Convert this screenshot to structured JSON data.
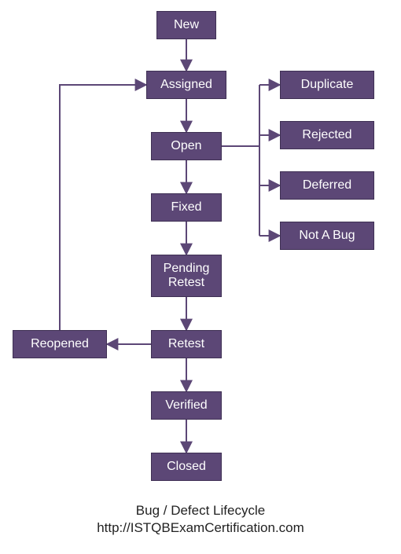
{
  "chart_data": {
    "type": "flowchart",
    "title": "Bug / Defect Lifecycle",
    "nodes": [
      {
        "id": "new",
        "label": "New"
      },
      {
        "id": "assigned",
        "label": "Assigned"
      },
      {
        "id": "open",
        "label": "Open"
      },
      {
        "id": "fixed",
        "label": "Fixed"
      },
      {
        "id": "pending_retest",
        "label": "Pending Retest"
      },
      {
        "id": "retest",
        "label": "Retest"
      },
      {
        "id": "verified",
        "label": "Verified"
      },
      {
        "id": "closed",
        "label": "Closed"
      },
      {
        "id": "reopened",
        "label": "Reopened"
      },
      {
        "id": "duplicate",
        "label": "Duplicate"
      },
      {
        "id": "rejected",
        "label": "Rejected"
      },
      {
        "id": "deferred",
        "label": "Deferred"
      },
      {
        "id": "not_a_bug",
        "label": "Not A Bug"
      }
    ],
    "edges": [
      {
        "from": "new",
        "to": "assigned"
      },
      {
        "from": "assigned",
        "to": "open"
      },
      {
        "from": "open",
        "to": "fixed"
      },
      {
        "from": "open",
        "to": "duplicate"
      },
      {
        "from": "open",
        "to": "rejected"
      },
      {
        "from": "open",
        "to": "deferred"
      },
      {
        "from": "open",
        "to": "not_a_bug"
      },
      {
        "from": "fixed",
        "to": "pending_retest"
      },
      {
        "from": "pending_retest",
        "to": "retest"
      },
      {
        "from": "retest",
        "to": "verified"
      },
      {
        "from": "retest",
        "to": "reopened"
      },
      {
        "from": "reopened",
        "to": "assigned"
      },
      {
        "from": "verified",
        "to": "closed"
      }
    ]
  },
  "caption": {
    "line1": "Bug / Defect Lifecycle",
    "line2": "http://ISTQBExamCertification.com"
  },
  "colors": {
    "node_fill": "#5c4776",
    "node_text": "#ffffff",
    "edge": "#5c4776"
  }
}
